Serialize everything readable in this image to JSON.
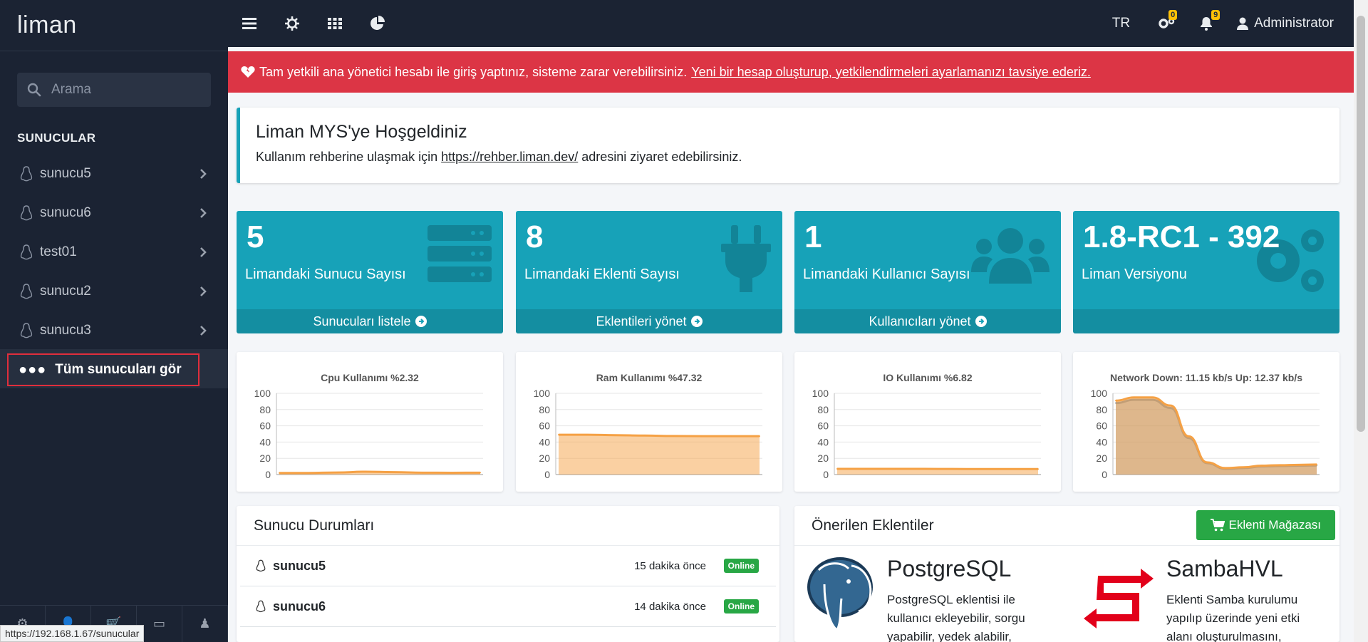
{
  "sidebar": {
    "brand": "liman",
    "search_placeholder": "Arama",
    "section_title": "SUNUCULAR",
    "servers": [
      {
        "label": "sunucu5"
      },
      {
        "label": "sunucu6"
      },
      {
        "label": "test01"
      },
      {
        "label": "sunucu2"
      },
      {
        "label": "sunucu3"
      }
    ],
    "all_servers_label": "Tüm sunucuları gör",
    "footer_icons": [
      "gears-icon",
      "user-icon",
      "cart-icon",
      "wallet-icon",
      "user-secret-icon"
    ]
  },
  "status_url": "https://192.168.1.67/sunucular",
  "topbar": {
    "language": "TR",
    "settings_badge": "0",
    "notifications_badge": "9",
    "user_name": "Administrator"
  },
  "alert": {
    "text": "Tam yetkili ana yönetici hesabı ile giriş yaptınız, sisteme zarar verebilirsiniz.",
    "link_text": "Yeni bir hesap oluşturup, yetkilendirmeleri ayarlamanızı tavsiye ederiz."
  },
  "welcome": {
    "title": "Liman MYS'ye Hoşgeldiniz",
    "text_before": "Kullanım rehberine ulaşmak için",
    "link": "https://rehber.liman.dev/",
    "text_after": "adresini ziyaret edebilirsiniz."
  },
  "stats": [
    {
      "value": "5",
      "label": "Limandaki Sunucu Sayısı",
      "footer": "Sunucuları listele",
      "icon": "server-icon"
    },
    {
      "value": "8",
      "label": "Limandaki Eklenti Sayısı",
      "footer": "Eklentileri yönet",
      "icon": "plug-icon"
    },
    {
      "value": "1",
      "label": "Limandaki Kullanıcı Sayısı",
      "footer": "Kullanıcıları yönet",
      "icon": "users-icon"
    },
    {
      "value": "1.8-RC1 - 392",
      "label": "Liman Versiyonu",
      "footer": "",
      "icon": "cogs-icon"
    }
  ],
  "chart_data": [
    {
      "type": "area",
      "title": "Cpu Kullanımı %2.32",
      "ylim": [
        0,
        100
      ],
      "y_ticks": [
        "100",
        "80",
        "60",
        "40",
        "20",
        "0"
      ],
      "values": [
        2,
        2,
        2.5,
        3.5,
        3,
        2.3,
        2.2,
        2.3
      ],
      "color": "#f5a145"
    },
    {
      "type": "area",
      "title": "Ram Kullanımı %47.32",
      "ylim": [
        0,
        100
      ],
      "y_ticks": [
        "100",
        "80",
        "60",
        "40",
        "20",
        "0"
      ],
      "values": [
        49,
        49,
        48.5,
        48,
        47.5,
        47.3,
        47.3,
        47.3
      ],
      "color": "#f5a145"
    },
    {
      "type": "area",
      "title": "IO Kullanımı %6.82",
      "ylim": [
        0,
        100
      ],
      "y_ticks": [
        "100",
        "80",
        "60",
        "40",
        "20",
        "0"
      ],
      "values": [
        7,
        7,
        7,
        7,
        6.9,
        6.8,
        6.8,
        6.8
      ],
      "color": "#f5a145"
    },
    {
      "type": "area",
      "title": "Network Down: 11.15 kb/s Up: 12.37 kb/s",
      "ylim": [
        0,
        100
      ],
      "y_ticks": [
        "100",
        "80",
        "60",
        "40",
        "20",
        "0"
      ],
      "series": [
        {
          "name": "Down",
          "values": [
            88,
            92,
            92,
            82,
            45,
            14,
            7,
            8,
            10,
            10.5,
            11,
            11.15
          ],
          "color": "#8e9aa6"
        },
        {
          "name": "Up",
          "values": [
            91,
            95,
            95,
            85,
            47,
            15,
            8,
            9,
            11,
            11.5,
            12,
            12.37
          ],
          "color": "#f5a145"
        }
      ]
    }
  ],
  "server_status": {
    "title": "Sunucu Durumları",
    "rows": [
      {
        "name": "sunucu5",
        "time": "15 dakika önce",
        "status": "Online"
      },
      {
        "name": "sunucu6",
        "time": "14 dakika önce",
        "status": "Online"
      }
    ]
  },
  "recommended": {
    "title": "Önerilen Eklentiler",
    "store_button": "Eklenti Mağazası",
    "extensions": [
      {
        "name": "PostgreSQL",
        "desc_lines": [
          "PostgreSQL eklentisi ile",
          "kullanıcı ekleyebilir, sorgu",
          "yapabilir, yedek alabilir,"
        ]
      },
      {
        "name": "SambaHVL",
        "desc_lines": [
          "Eklenti Samba kurulumu",
          "yapılıp üzerinde yeni etki",
          "alanı oluşturulmasını,"
        ]
      }
    ]
  }
}
